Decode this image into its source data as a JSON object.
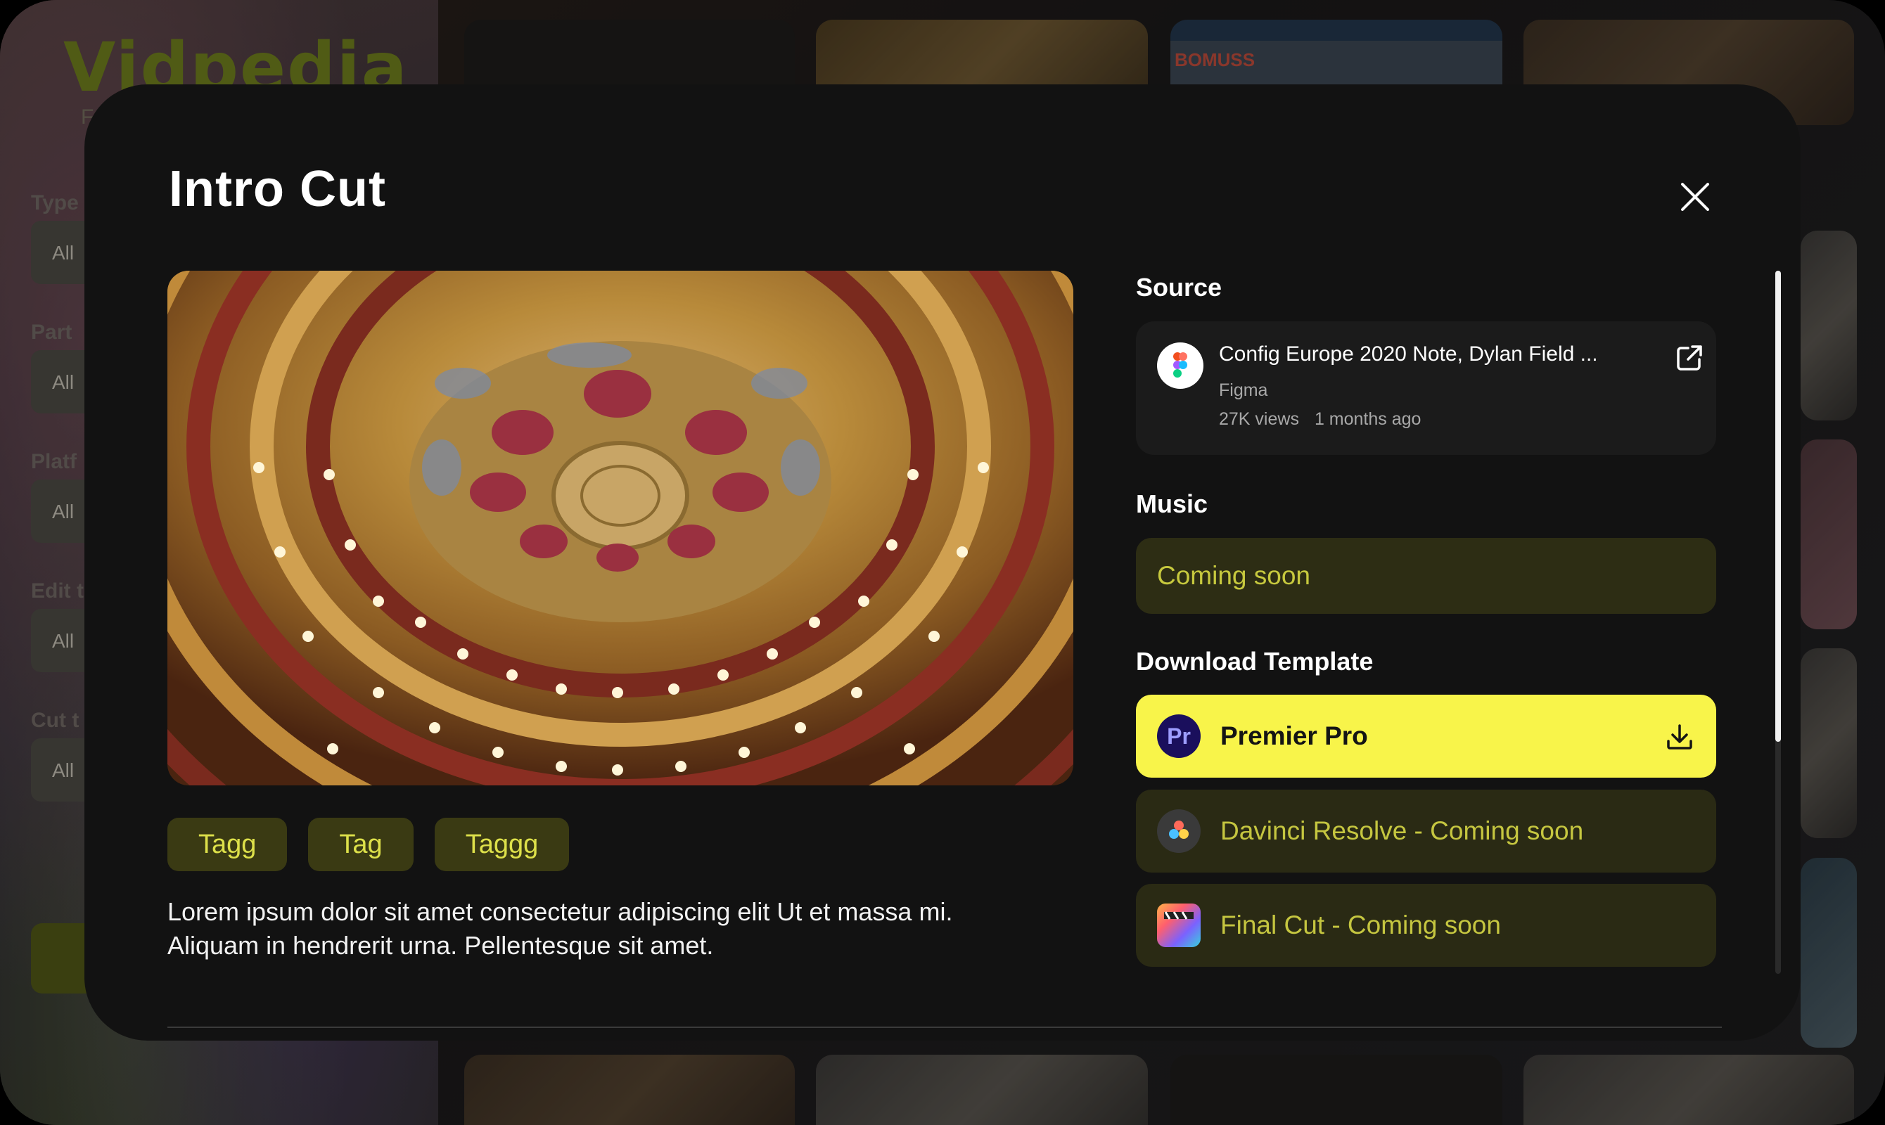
{
  "background": {
    "logo": "Vidpedia",
    "subtitle": "F",
    "filters": [
      {
        "label": "Type",
        "value": "All"
      },
      {
        "label": "Part",
        "value": "All"
      },
      {
        "label": "Platf",
        "value": "All"
      },
      {
        "label": "Edit t",
        "value": "All"
      },
      {
        "label": "Cut t",
        "value": "All"
      }
    ],
    "tile_text": "BOMUSS"
  },
  "modal": {
    "title": "Intro Cut",
    "tags": [
      "Tagg",
      "Tag",
      "Taggg"
    ],
    "description": "Lorem ipsum dolor sit amet consectetur adipiscing elit Ut et massa mi. Aliquam in hendrerit urna. Pellentesque sit amet.",
    "source": {
      "heading": "Source",
      "title": "Config Europe 2020 Note, Dylan Field ...",
      "channel": "Figma",
      "views": "27K views",
      "age": "1 months ago",
      "icon": "external-link-icon"
    },
    "music": {
      "heading": "Music",
      "status": "Coming soon"
    },
    "download": {
      "heading": "Download Template",
      "options": [
        {
          "label": "Premier Pro",
          "icon": "premiere-pro-icon",
          "active": true
        },
        {
          "label": "Davinci Resolve - Coming soon",
          "icon": "davinci-resolve-icon",
          "active": false
        },
        {
          "label": "Final Cut - Coming soon",
          "icon": "final-cut-icon",
          "active": false
        }
      ]
    }
  },
  "colors": {
    "accent_yellow": "#f8f44a",
    "tag_bg": "#3a3a13",
    "tag_text": "#dde04a",
    "modal_bg": "#121212"
  }
}
